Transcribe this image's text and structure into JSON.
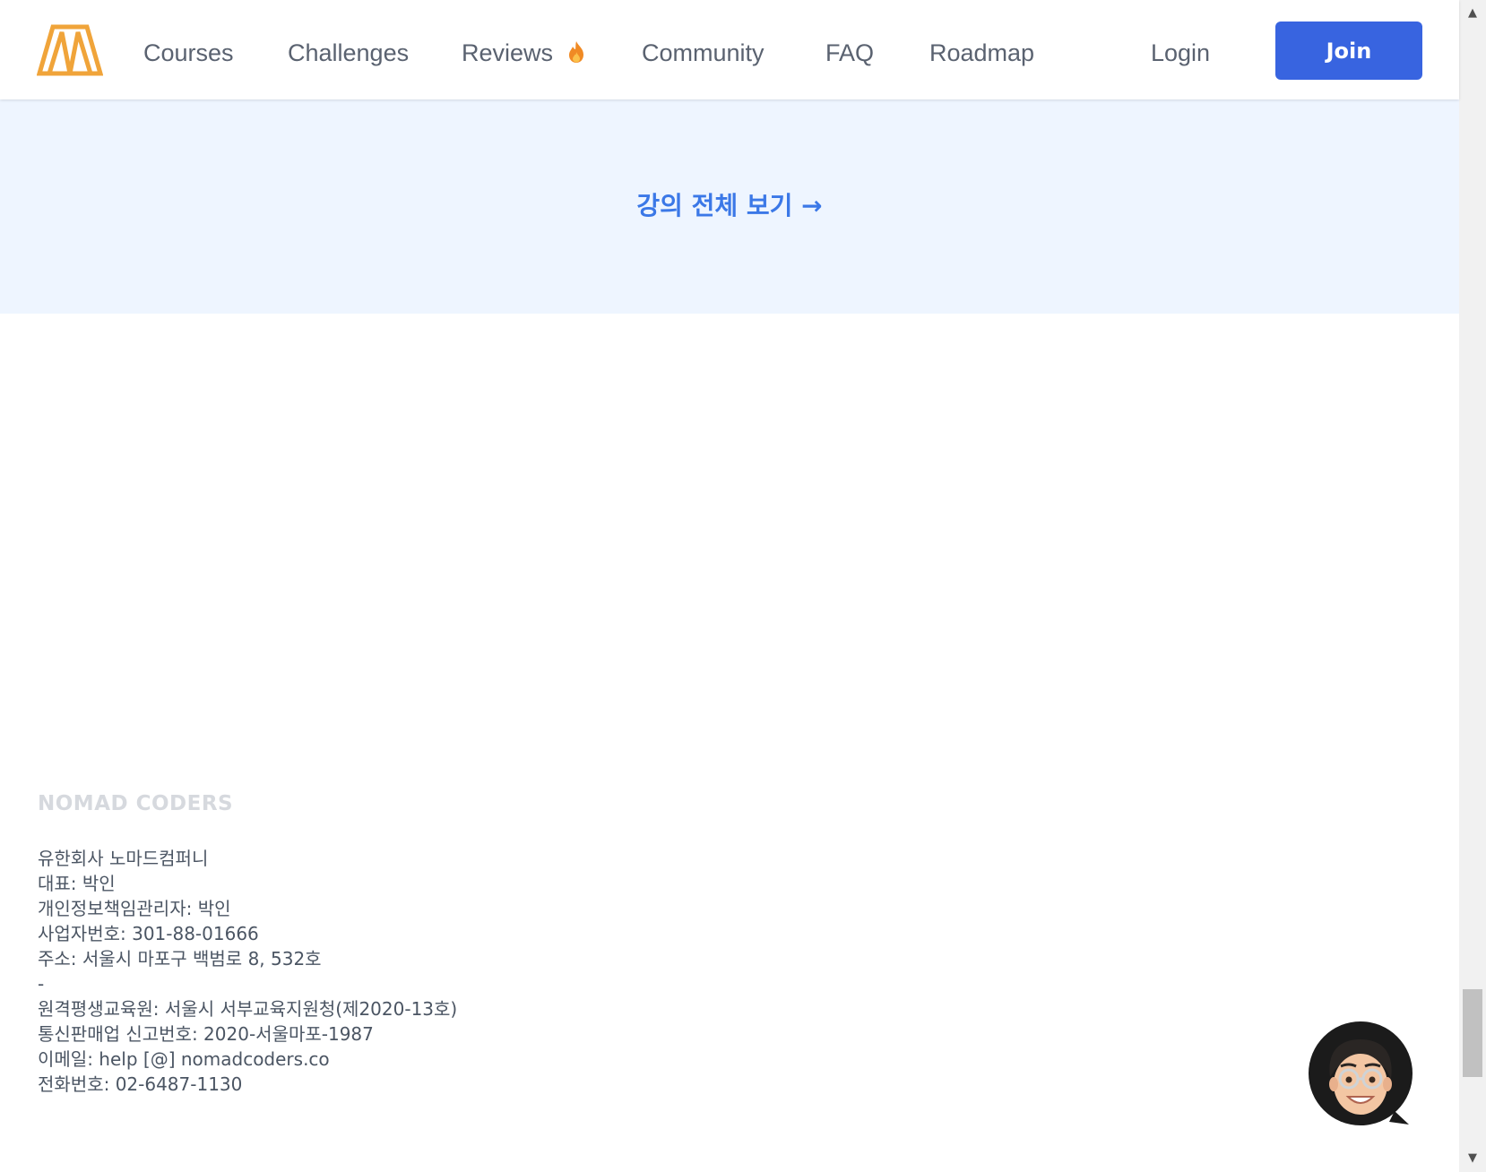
{
  "header": {
    "logo_icon": "nomad-coders-logo-icon",
    "nav": [
      {
        "label": "Courses"
      },
      {
        "label": "Challenges"
      },
      {
        "label": "Reviews",
        "badge_icon": "fire-icon"
      },
      {
        "label": "Community"
      },
      {
        "label": "FAQ"
      },
      {
        "label": "Roadmap"
      }
    ],
    "login_label": "Login",
    "join_label": "Join"
  },
  "banner": {
    "link_text": "강의 전체 보기 →"
  },
  "footer": {
    "brand": "NOMAD CODERS",
    "lines": [
      "유한회사 노마드컴퍼니",
      "대표: 박인",
      "개인정보책임관리자: 박인",
      "사업자번호: 301-88-01666",
      "주소: 서울시 마포구 백범로 8, 532호",
      "-",
      "원격평생교육원: 서울시 서부교육지원청(제2020-13호)",
      "통신판매업 신고번호: 2020-서울마포-1987",
      "이메일: help [@] nomadcoders.co",
      "전화번호: 02-6487-1130"
    ]
  },
  "chat": {
    "avatar_icon": "chat-avatar-icon"
  },
  "colors": {
    "accent": "#3864e0",
    "link": "#3b78e7",
    "logo": "#f0a43a",
    "banner_bg": "#eef5ff",
    "nav_text": "#5a6270",
    "footer_text": "#4b5563",
    "brand_text": "#d6d9de"
  }
}
